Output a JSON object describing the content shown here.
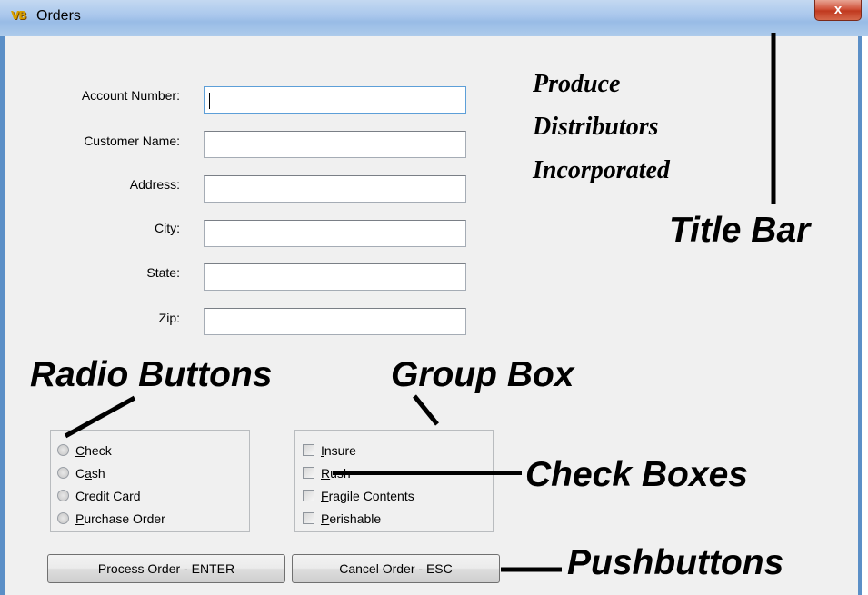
{
  "window": {
    "title": "Orders",
    "app_icon": "vb-app-icon",
    "app_icon_text": "VB",
    "close_glyph": "x"
  },
  "form": {
    "fields": [
      {
        "label": "Account Number:",
        "value": "",
        "focused": true
      },
      {
        "label": "Customer Name:",
        "value": ""
      },
      {
        "label": "Address:",
        "value": ""
      },
      {
        "label": "City:",
        "value": ""
      },
      {
        "label": "State:",
        "value": ""
      },
      {
        "label": "Zip:",
        "value": ""
      }
    ]
  },
  "company": {
    "line1": "Produce",
    "line2": "Distributors",
    "line3": "Incorporated"
  },
  "payment_group": {
    "options": [
      {
        "mnemonic": "C",
        "rest": "heck",
        "selected": false
      },
      {
        "pre": "C",
        "mnemonic": "a",
        "rest": "sh",
        "selected": false
      },
      {
        "mnemonic": "",
        "rest": "Credit Card",
        "selected": false
      },
      {
        "mnemonic": "P",
        "rest": "urchase Order",
        "selected": false
      }
    ]
  },
  "options_group": {
    "items": [
      {
        "mnemonic": "I",
        "rest": "nsure",
        "checked": false
      },
      {
        "mnemonic": "R",
        "rest": "ush",
        "checked": false
      },
      {
        "mnemonic": "F",
        "rest": "ragile Contents",
        "checked": false
      },
      {
        "mnemonic": "P",
        "rest": "erishable",
        "checked": false
      }
    ]
  },
  "buttons": {
    "process": "Process Order - ENTER",
    "cancel": "Cancel Order - ESC"
  },
  "callouts": {
    "title_bar": "Title Bar",
    "radio_buttons": "Radio Buttons",
    "group_box": "Group Box",
    "check_boxes": "Check Boxes",
    "pushbuttons": "Pushbuttons"
  }
}
